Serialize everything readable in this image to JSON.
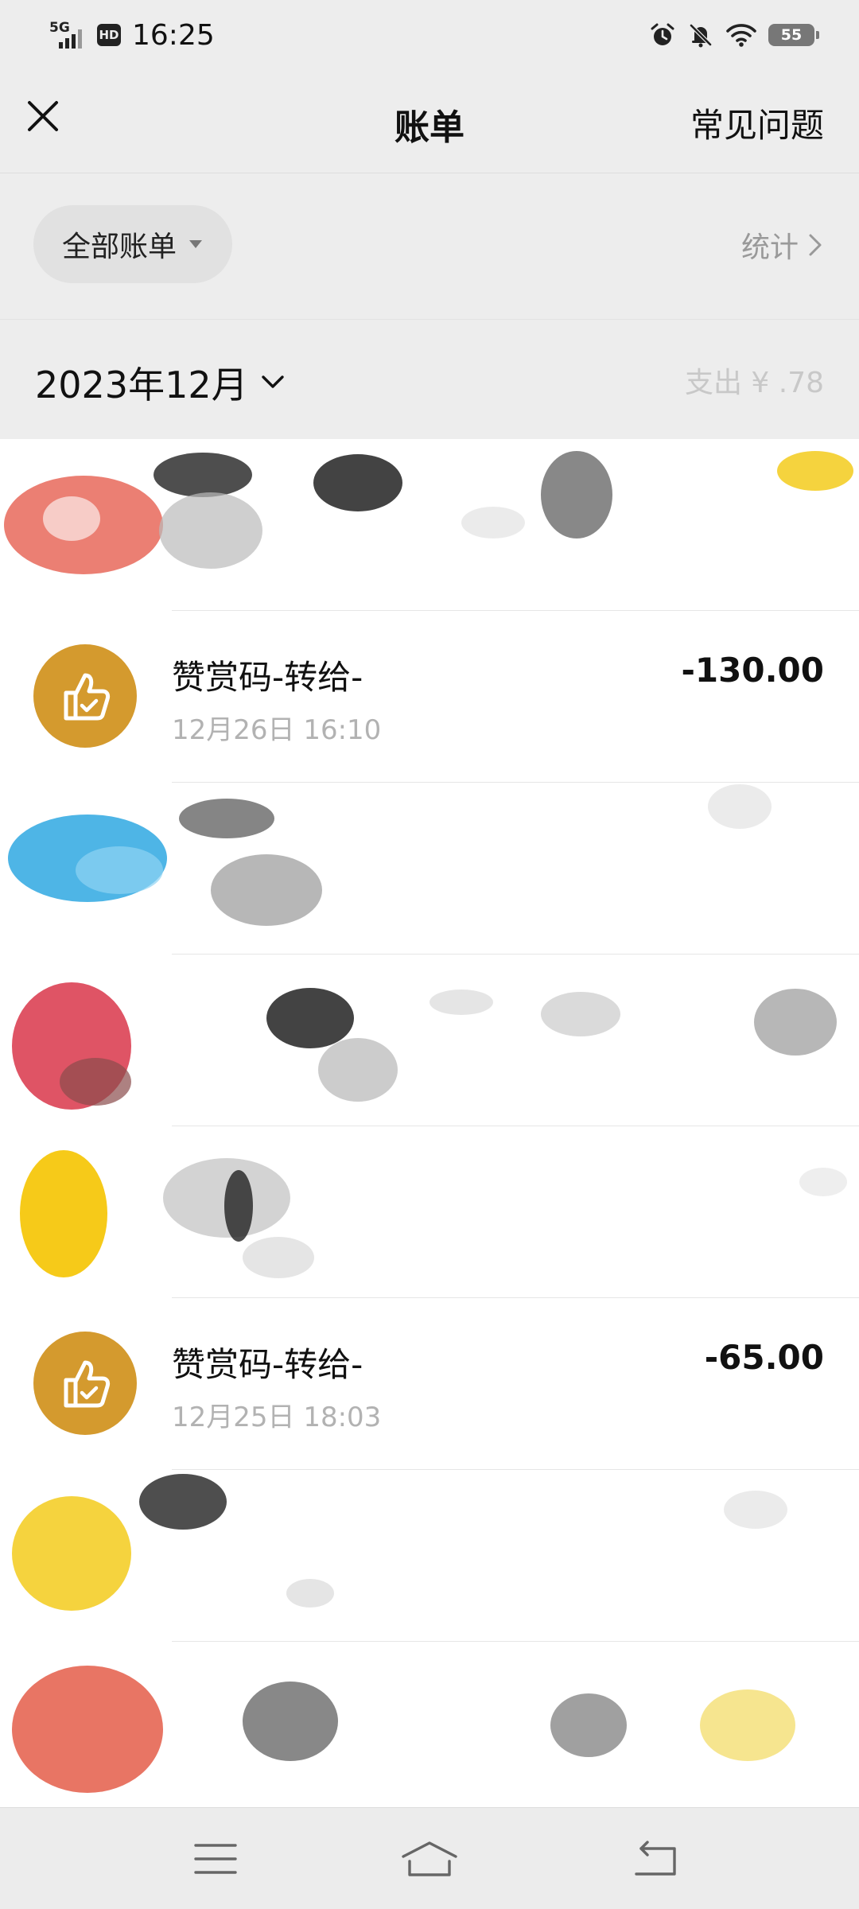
{
  "status_bar": {
    "network": "5G",
    "hd": "HD",
    "time": "16:25",
    "battery": "55"
  },
  "header": {
    "title": "账单",
    "faq_label": "常见问题",
    "close_icon": "close-icon"
  },
  "filter": {
    "label": "全部账单",
    "stats_label": "统计"
  },
  "month": {
    "label": "2023年12月",
    "summary": "支出 ¥ .78"
  },
  "bills": [
    {
      "title": "",
      "time": "",
      "amount": "",
      "icon_color": "#e8695a",
      "redacted": true
    },
    {
      "title": "赞赏码-转给-",
      "time": "12月26日 16:10",
      "amount": "-130.00",
      "icon_color": "#d49a2e",
      "icon": "thumbs-up-icon",
      "redacted": false
    },
    {
      "title": "",
      "time": "",
      "amount": "",
      "icon_color": "#2fa8e2",
      "redacted": true
    },
    {
      "title": "",
      "time": "",
      "amount": "",
      "icon_color": "#d9364a",
      "redacted": true
    },
    {
      "title": "",
      "time": "",
      "amount": "",
      "icon_color": "#f5c400",
      "redacted": true
    },
    {
      "title": "赞赏码-转给-",
      "time": "12月25日 18:03",
      "amount": "-65.00",
      "icon_color": "#d49a2e",
      "icon": "thumbs-up-icon",
      "redacted": false
    },
    {
      "title": "",
      "time": "",
      "amount": "",
      "icon_color": "#f3cb1c",
      "redacted": true
    },
    {
      "title": "",
      "time": "",
      "amount": "",
      "icon_color": "#e5624f",
      "redacted": true
    }
  ],
  "nav": {
    "menu_icon": "menu-icon",
    "home_icon": "home-icon",
    "back_icon": "back-icon"
  }
}
